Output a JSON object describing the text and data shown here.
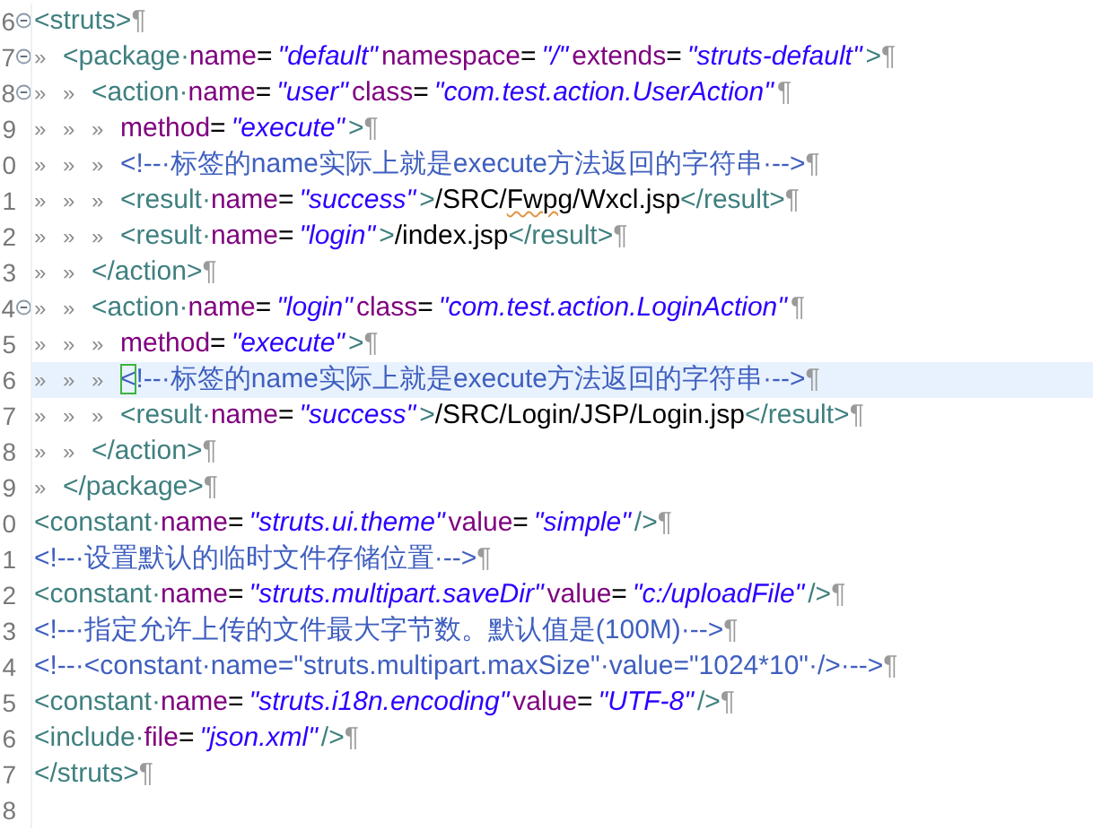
{
  "editor": {
    "lines": [
      {
        "number": "6",
        "expanded": true,
        "current": false,
        "tokens": [
          {
            "kind": "tag",
            "text": "<struts>"
          },
          {
            "kind": "eol",
            "text": "¶"
          }
        ]
      },
      {
        "number": "7",
        "expanded": true,
        "current": false,
        "tokens": [
          {
            "kind": "tab",
            "text": "»"
          },
          {
            "kind": "tag",
            "text": "<package·"
          },
          {
            "kind": "attr",
            "text": "name"
          },
          {
            "kind": "eq",
            "text": "="
          },
          {
            "kind": "val",
            "text": "\"default\""
          },
          {
            "kind": "attr",
            "text": "namespace"
          },
          {
            "kind": "eq",
            "text": "="
          },
          {
            "kind": "val",
            "text": "\"/\""
          },
          {
            "kind": "attr",
            "text": "extends"
          },
          {
            "kind": "eq",
            "text": "="
          },
          {
            "kind": "val",
            "text": "\"struts-default\""
          },
          {
            "kind": "tag",
            "text": ">"
          },
          {
            "kind": "eol",
            "text": "¶"
          }
        ]
      },
      {
        "number": "8",
        "expanded": true,
        "current": false,
        "tokens": [
          {
            "kind": "tab",
            "text": "»"
          },
          {
            "kind": "tab",
            "text": "»"
          },
          {
            "kind": "tag",
            "text": "<action·"
          },
          {
            "kind": "attr",
            "text": "name"
          },
          {
            "kind": "eq",
            "text": "="
          },
          {
            "kind": "val",
            "text": "\"user\""
          },
          {
            "kind": "attr",
            "text": "class"
          },
          {
            "kind": "eq",
            "text": "="
          },
          {
            "kind": "val",
            "text": "\"com.test.action.UserAction\""
          },
          {
            "kind": "eol",
            "text": "¶"
          }
        ]
      },
      {
        "number": "9",
        "current": false,
        "tokens": [
          {
            "kind": "tab",
            "text": "»"
          },
          {
            "kind": "tab",
            "text": "»"
          },
          {
            "kind": "tab",
            "text": "»"
          },
          {
            "kind": "attr",
            "text": "method"
          },
          {
            "kind": "eq",
            "text": "="
          },
          {
            "kind": "val",
            "text": "\"execute\""
          },
          {
            "kind": "tag",
            "text": ">"
          },
          {
            "kind": "eol",
            "text": "¶"
          }
        ]
      },
      {
        "number": "0",
        "current": false,
        "tokens": [
          {
            "kind": "tab",
            "text": "»"
          },
          {
            "kind": "tab",
            "text": "»"
          },
          {
            "kind": "tab",
            "text": "»"
          },
          {
            "kind": "comment",
            "text": "<!--·标签的name实际上就是execute方法返回的字符串·-->"
          },
          {
            "kind": "eol",
            "text": "¶"
          }
        ]
      },
      {
        "number": "1",
        "current": false,
        "tokens": [
          {
            "kind": "tab",
            "text": "»"
          },
          {
            "kind": "tab",
            "text": "»"
          },
          {
            "kind": "tab",
            "text": "»"
          },
          {
            "kind": "tag",
            "text": "<result·"
          },
          {
            "kind": "attr",
            "text": "name"
          },
          {
            "kind": "eq",
            "text": "="
          },
          {
            "kind": "val",
            "text": "\"success\""
          },
          {
            "kind": "tag",
            "text": ">"
          },
          {
            "kind": "text",
            "text": "/SRC/"
          },
          {
            "kind": "text",
            "text": "Fwpg",
            "misspelled": true
          },
          {
            "kind": "text",
            "text": "/Wxcl.jsp"
          },
          {
            "kind": "tag",
            "text": "</result>"
          },
          {
            "kind": "eol",
            "text": "¶"
          }
        ]
      },
      {
        "number": "2",
        "current": false,
        "tokens": [
          {
            "kind": "tab",
            "text": "»"
          },
          {
            "kind": "tab",
            "text": "»"
          },
          {
            "kind": "tab",
            "text": "»"
          },
          {
            "kind": "tag",
            "text": "<result·"
          },
          {
            "kind": "attr",
            "text": "name"
          },
          {
            "kind": "eq",
            "text": "="
          },
          {
            "kind": "val",
            "text": "\"login\""
          },
          {
            "kind": "tag",
            "text": ">"
          },
          {
            "kind": "text",
            "text": "/index.jsp"
          },
          {
            "kind": "tag",
            "text": "</result>"
          },
          {
            "kind": "eol",
            "text": "¶"
          }
        ]
      },
      {
        "number": "3",
        "current": false,
        "tokens": [
          {
            "kind": "tab",
            "text": "»"
          },
          {
            "kind": "tab",
            "text": "»"
          },
          {
            "kind": "tag",
            "text": "</action>"
          },
          {
            "kind": "eol",
            "text": "¶"
          }
        ]
      },
      {
        "number": "4",
        "expanded": true,
        "current": false,
        "tokens": [
          {
            "kind": "tab",
            "text": "»"
          },
          {
            "kind": "tab",
            "text": "»"
          },
          {
            "kind": "tag",
            "text": "<action·"
          },
          {
            "kind": "attr",
            "text": "name"
          },
          {
            "kind": "eq",
            "text": "="
          },
          {
            "kind": "val",
            "text": "\"login\""
          },
          {
            "kind": "attr",
            "text": "class"
          },
          {
            "kind": "eq",
            "text": "="
          },
          {
            "kind": "val",
            "text": "\"com.test.action.LoginAction\""
          },
          {
            "kind": "eol",
            "text": "¶"
          }
        ]
      },
      {
        "number": "5",
        "current": false,
        "tokens": [
          {
            "kind": "tab",
            "text": "»"
          },
          {
            "kind": "tab",
            "text": "»"
          },
          {
            "kind": "tab",
            "text": "»"
          },
          {
            "kind": "attr",
            "text": "method"
          },
          {
            "kind": "eq",
            "text": "="
          },
          {
            "kind": "val",
            "text": "\"execute\""
          },
          {
            "kind": "tag",
            "text": ">"
          },
          {
            "kind": "eol",
            "text": "¶"
          }
        ]
      },
      {
        "number": "6",
        "current": true,
        "tokens": [
          {
            "kind": "tab",
            "text": "»"
          },
          {
            "kind": "tab",
            "text": "»"
          },
          {
            "kind": "tab",
            "text": "»"
          },
          {
            "kind": "comment",
            "text": "<",
            "matched": true
          },
          {
            "kind": "comment",
            "text": "!--·标签的name实际上就是execute方法返回的字符串·-->"
          },
          {
            "kind": "eol",
            "text": "¶"
          }
        ]
      },
      {
        "number": "7",
        "current": false,
        "tokens": [
          {
            "kind": "tab",
            "text": "»"
          },
          {
            "kind": "tab",
            "text": "»"
          },
          {
            "kind": "tab",
            "text": "»"
          },
          {
            "kind": "tag",
            "text": "<result·"
          },
          {
            "kind": "attr",
            "text": "name"
          },
          {
            "kind": "eq",
            "text": "="
          },
          {
            "kind": "val",
            "text": "\"success\""
          },
          {
            "kind": "tag",
            "text": ">"
          },
          {
            "kind": "text",
            "text": "/SRC/Login/JSP/Login.jsp"
          },
          {
            "kind": "tag",
            "text": "</result>"
          },
          {
            "kind": "eol",
            "text": "¶"
          }
        ]
      },
      {
        "number": "8",
        "current": false,
        "tokens": [
          {
            "kind": "tab",
            "text": "»"
          },
          {
            "kind": "tab",
            "text": "»"
          },
          {
            "kind": "tag",
            "text": "</action>"
          },
          {
            "kind": "eol",
            "text": "¶"
          }
        ]
      },
      {
        "number": "9",
        "current": false,
        "tokens": [
          {
            "kind": "tab",
            "text": "»"
          },
          {
            "kind": "tag",
            "text": "</package>"
          },
          {
            "kind": "eol",
            "text": "¶"
          }
        ]
      },
      {
        "number": "0",
        "current": false,
        "tokens": [
          {
            "kind": "tag",
            "text": "<constant·"
          },
          {
            "kind": "attr",
            "text": "name"
          },
          {
            "kind": "eq",
            "text": "="
          },
          {
            "kind": "val",
            "text": "\"struts.ui.theme\""
          },
          {
            "kind": "attr",
            "text": "value"
          },
          {
            "kind": "eq",
            "text": "="
          },
          {
            "kind": "val",
            "text": "\"simple\""
          },
          {
            "kind": "tag",
            "text": "/>"
          },
          {
            "kind": "eol",
            "text": "¶"
          }
        ]
      },
      {
        "number": "1",
        "current": false,
        "tokens": [
          {
            "kind": "comment",
            "text": "<!--·设置默认的临时文件存储位置·-->"
          },
          {
            "kind": "eol",
            "text": "¶"
          }
        ]
      },
      {
        "number": "2",
        "current": false,
        "tokens": [
          {
            "kind": "tag",
            "text": "<constant·"
          },
          {
            "kind": "attr",
            "text": "name"
          },
          {
            "kind": "eq",
            "text": "="
          },
          {
            "kind": "val",
            "text": "\"struts.multipart.saveDir\""
          },
          {
            "kind": "attr",
            "text": "value"
          },
          {
            "kind": "eq",
            "text": "="
          },
          {
            "kind": "val",
            "text": "\"c:/uploadFile\""
          },
          {
            "kind": "tag",
            "text": "/>"
          },
          {
            "kind": "eol",
            "text": "¶"
          }
        ]
      },
      {
        "number": "3",
        "current": false,
        "tokens": [
          {
            "kind": "comment",
            "text": "<!--·指定允许上传的文件最大字节数。默认值是(100M)·-->"
          },
          {
            "kind": "eol",
            "text": "¶"
          }
        ]
      },
      {
        "number": "4",
        "current": false,
        "tokens": [
          {
            "kind": "comment",
            "text": "<!--·<constant·name=\"struts.multipart.maxSize\"·value=\"1024*10\"·/>·-->"
          },
          {
            "kind": "eol",
            "text": "¶"
          }
        ]
      },
      {
        "number": "5",
        "current": false,
        "tokens": [
          {
            "kind": "tag",
            "text": "<constant·"
          },
          {
            "kind": "attr",
            "text": "name"
          },
          {
            "kind": "eq",
            "text": "="
          },
          {
            "kind": "val",
            "text": "\"struts.i18n.encoding\""
          },
          {
            "kind": "attr",
            "text": "value"
          },
          {
            "kind": "eq",
            "text": "="
          },
          {
            "kind": "val",
            "text": "\"UTF-8\""
          },
          {
            "kind": "tag",
            "text": "/>"
          },
          {
            "kind": "eol",
            "text": "¶"
          }
        ]
      },
      {
        "number": "6",
        "current": false,
        "tokens": [
          {
            "kind": "tag",
            "text": "<include·"
          },
          {
            "kind": "attr",
            "text": "file"
          },
          {
            "kind": "eq",
            "text": "="
          },
          {
            "kind": "val",
            "text": "\"json.xml\""
          },
          {
            "kind": "tag",
            "text": "/>"
          },
          {
            "kind": "eol",
            "text": "¶"
          }
        ]
      },
      {
        "number": "7",
        "current": false,
        "tokens": [
          {
            "kind": "tag",
            "text": "</struts>"
          },
          {
            "kind": "eol",
            "text": "¶"
          }
        ]
      },
      {
        "number": "8",
        "current": false
      }
    ]
  }
}
